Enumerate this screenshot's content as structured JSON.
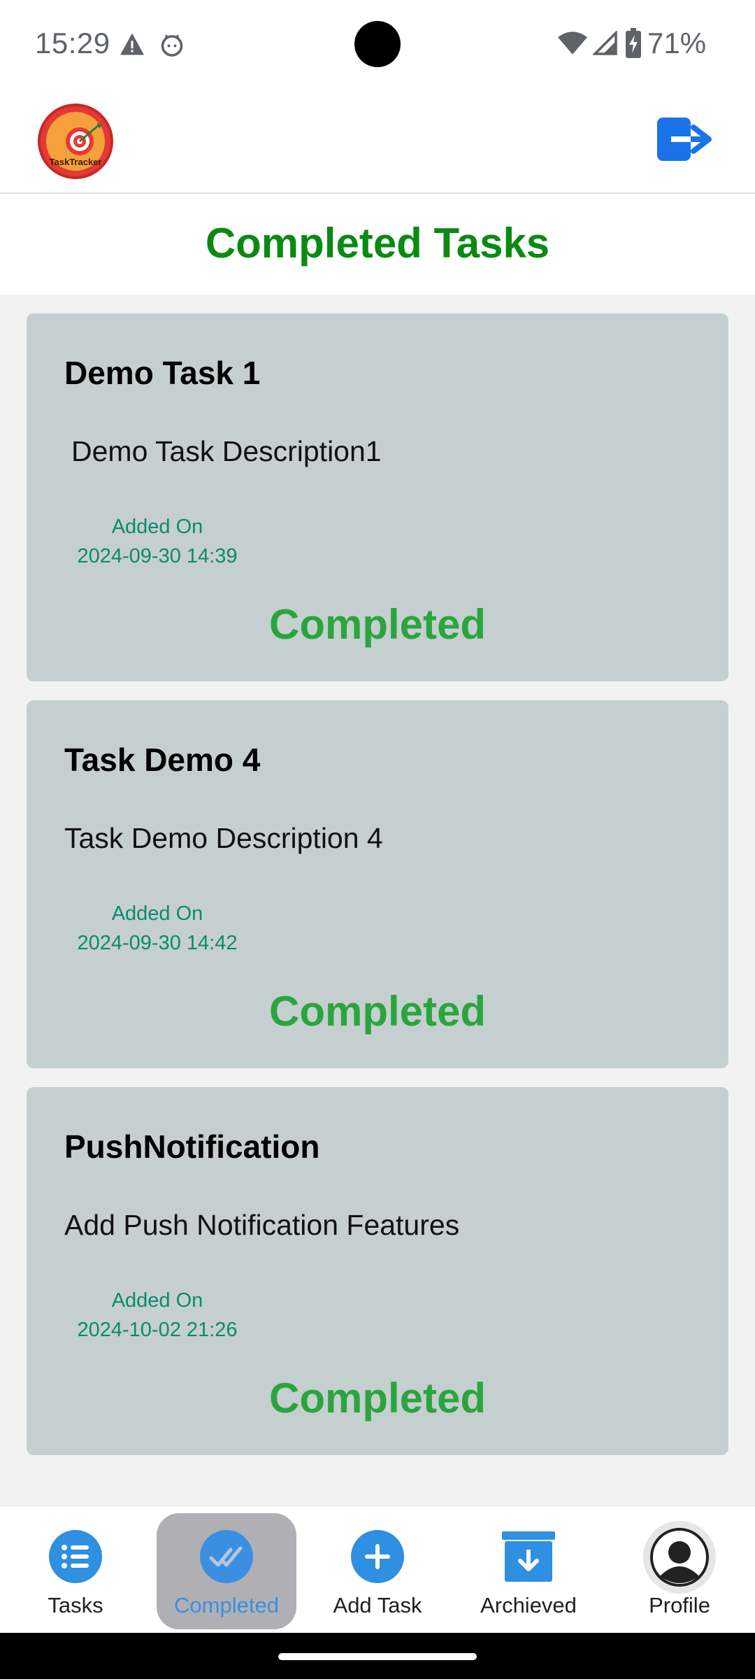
{
  "status_bar": {
    "time": "15:29",
    "battery": "71%"
  },
  "app_bar": {
    "logo_text": "TaskTracker",
    "logout_icon": "logout-icon"
  },
  "page": {
    "title": "Completed Tasks"
  },
  "tasks": [
    {
      "title": "Demo Task 1",
      "description": "Demo Task Description1",
      "added_label": "Added On",
      "added_on": "2024-09-30 14:39",
      "status": "Completed"
    },
    {
      "title": "Task Demo 4",
      "description": "Task Demo Description 4",
      "added_label": "Added On",
      "added_on": "2024-09-30 14:42",
      "status": "Completed"
    },
    {
      "title": "PushNotification",
      "description": "Add Push Notification Features",
      "added_label": "Added On",
      "added_on": "2024-10-02 21:26",
      "status": "Completed"
    }
  ],
  "bottom_nav": {
    "items": [
      {
        "label": "Tasks",
        "icon": "list-icon"
      },
      {
        "label": "Completed",
        "icon": "double-check-icon",
        "active": true
      },
      {
        "label": "Add Task",
        "icon": "plus-icon"
      },
      {
        "label": "Archieved",
        "icon": "archive-icon"
      },
      {
        "label": "Profile",
        "icon": "profile-icon"
      }
    ]
  },
  "colors": {
    "title_green": "#0a8a12",
    "status_green": "#2aa53d",
    "date_teal": "#0b8a6e",
    "card_bg": "#c6cfcf",
    "accent_blue": "#3a8fe0"
  }
}
